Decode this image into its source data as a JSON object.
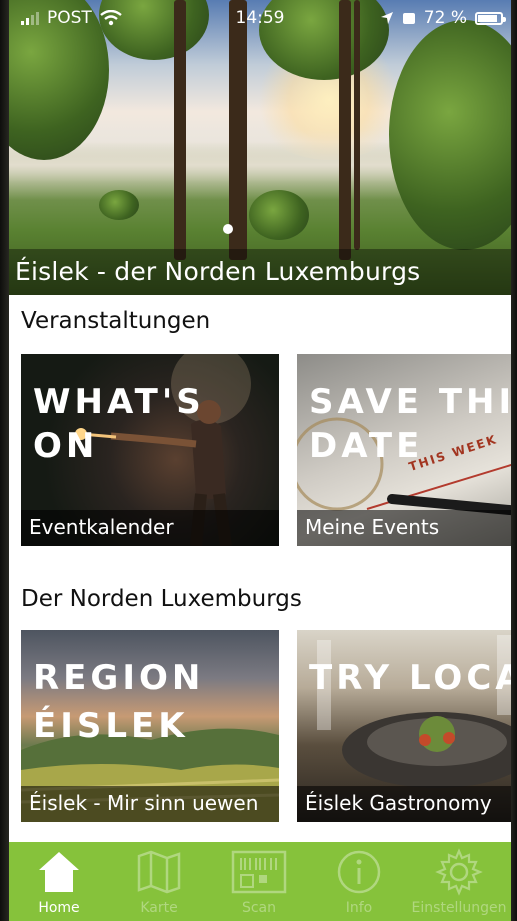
{
  "status_bar": {
    "carrier": "POST",
    "time": "14:59",
    "battery": "72 %"
  },
  "hero": {
    "caption": "Éislek - der Norden Luxemburgs"
  },
  "sections": [
    {
      "title": "Veranstaltungen",
      "tiles": [
        {
          "headline_1": "WHAT'S ON",
          "headline_2": "",
          "caption": "Eventkalender"
        },
        {
          "headline_1": "SAVE THIS",
          "headline_2": "DATE",
          "caption": "Meine Events",
          "overlay_text": "THIS WEEK"
        }
      ]
    },
    {
      "title": "Der Norden Luxemburgs",
      "tiles": [
        {
          "headline_1": "REGION",
          "headline_2": "ÉISLEK",
          "caption": "Éislek - Mir sinn uewen"
        },
        {
          "headline_1": "TRY LOCAL",
          "headline_2": "",
          "caption": "Éislek Gastronomy"
        }
      ]
    }
  ],
  "tab_bar": {
    "accent": "#86c23b",
    "items": [
      {
        "label": "Home",
        "icon": "home-icon",
        "active": true
      },
      {
        "label": "Karte",
        "icon": "map-icon",
        "active": false
      },
      {
        "label": "Scan",
        "icon": "scan-icon",
        "active": false
      },
      {
        "label": "Info",
        "icon": "info-icon",
        "active": false
      },
      {
        "label": "Einstellungen",
        "icon": "gear-icon",
        "active": false
      }
    ]
  }
}
